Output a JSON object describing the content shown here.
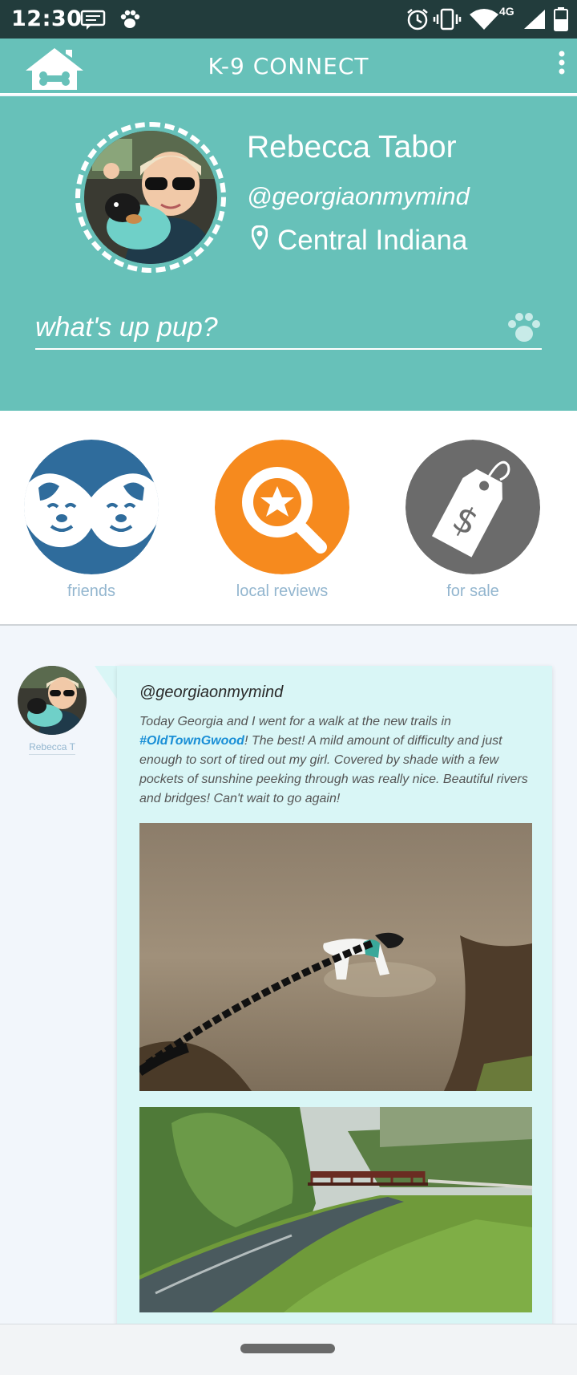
{
  "status_bar": {
    "time": "12:30",
    "network": "4G"
  },
  "app_bar": {
    "title": "K-9 CONNECT"
  },
  "profile": {
    "name": "Rebecca Tabor",
    "handle": "@georgiaonmymind",
    "location": "Central Indiana",
    "status_placeholder": "what's up pup?"
  },
  "actions": [
    {
      "label": "friends",
      "color": "#2f6c9c"
    },
    {
      "label": "local reviews",
      "color": "#f68a1e"
    },
    {
      "label": "for sale",
      "color": "#6b6b6b"
    }
  ],
  "post": {
    "author_name": "Rebecca T",
    "handle": "@georgiaonmymind",
    "text_before": "Today Georgia and I went for a walk at the new trails in ",
    "hashtag": "#OldTownGwood",
    "text_after": "! The best! A mild amount of difficulty and just enough to sort of tired out my girl. Covered by shade with a few pockets of sunshine peeking through was really nice. Beautiful rivers and bridges! Can't wait to go again!"
  },
  "colors": {
    "teal": "#67c1b9",
    "post_bg": "#d9f6f6",
    "label_blue": "#93b6cf",
    "hashtag": "#1a8fd6"
  }
}
